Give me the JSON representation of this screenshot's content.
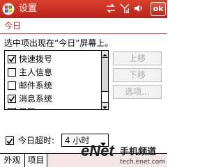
{
  "titlebar": {
    "title": "设置",
    "ok_label": "ok",
    "icons": [
      "windows-flag-icon",
      "sync-arrows-icon",
      "signal-icon",
      "volume-icon"
    ]
  },
  "page": {
    "title": "今日",
    "instruction": "选中项出现在“今日”屏幕上。"
  },
  "items": [
    {
      "label": "快速拨号",
      "checked": true
    },
    {
      "label": "主人信息",
      "checked": false
    },
    {
      "label": "邮件系统",
      "checked": false
    },
    {
      "label": "消息系统",
      "checked": true
    },
    {
      "label": "日历",
      "checked": false
    }
  ],
  "buttons": {
    "move_up": "上移",
    "move_down": "下移",
    "options": "选项..."
  },
  "timeout": {
    "checked": true,
    "label": "今日超时:",
    "value": "4 小时"
  },
  "tabs": {
    "appearance": "外观",
    "items": "项目"
  },
  "watermark": {
    "logo": "eNet",
    "text": "手机频道",
    "domain": "tech.enet.com.cn"
  },
  "colors": {
    "accent": "#c22a1e",
    "title_bar": "#c3281d"
  }
}
